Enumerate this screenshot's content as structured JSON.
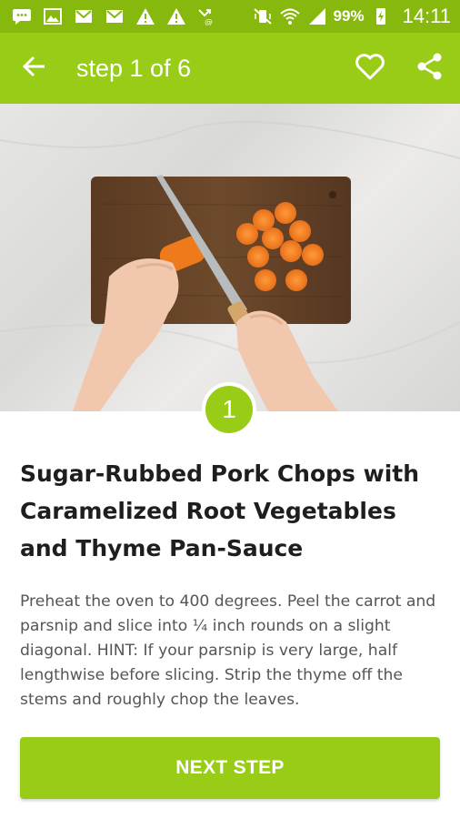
{
  "status_bar": {
    "left_icons": [
      "message-icon",
      "image-icon",
      "gmail-icon",
      "gmail-icon",
      "warning-icon",
      "warning-icon",
      "missed-call-icon"
    ],
    "right_icons": [
      "vibrate-icon",
      "wifi-icon",
      "signal-icon",
      "battery-charging-icon"
    ],
    "battery_percent": "99%",
    "time": "14:11"
  },
  "app_bar": {
    "title": "step 1 of 6",
    "back_icon": "arrow-back-icon",
    "favorite_icon": "heart-icon",
    "share_icon": "share-icon"
  },
  "step": {
    "number": "1",
    "title": "Sugar-Rubbed Pork Chops with Caramelized Root Vegetables and Thyme Pan-Sauce",
    "instructions": "Preheat the oven to 400 degrees. Peel the carrot and parsnip and slice into ¼ inch rounds on a slight diagonal. HINT: If your parsnip is very large, half lengthwise before slicing. Strip the thyme off the stems and roughly chop the leaves."
  },
  "next_button_label": "NEXT STEP",
  "colors": {
    "status_bar": "#86b80d",
    "accent": "#99cc16",
    "title_text": "#1e1e1e",
    "body_text": "#555555"
  }
}
